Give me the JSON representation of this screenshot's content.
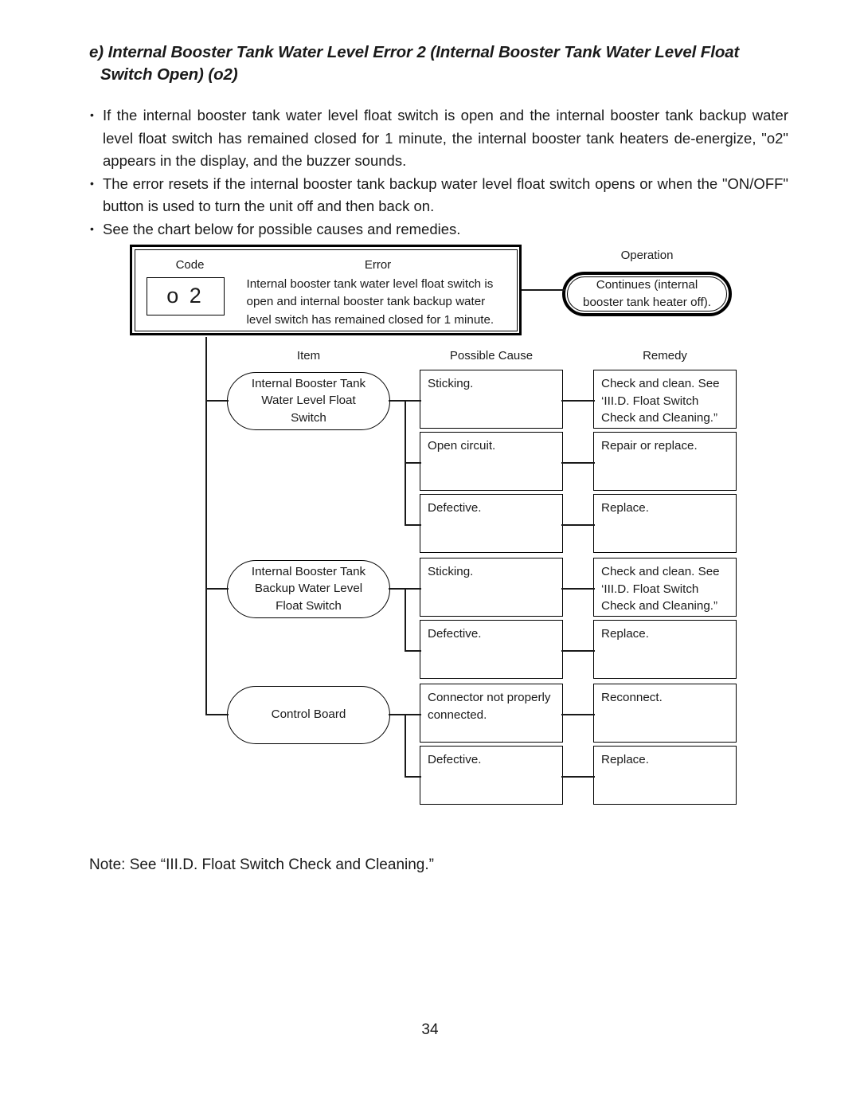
{
  "heading": {
    "line1": "e) Internal Booster Tank Water Level Error 2 (Internal Booster Tank Water Level Float",
    "line2": "Switch Open) (o2)"
  },
  "bullets": [
    "If the internal booster tank water level float switch is open and the internal booster tank backup water level float switch has remained closed for 1 minute, the internal booster tank heaters de-energize, \"o2\" appears in the display, and the buzzer sounds.",
    "The error resets if the internal booster tank backup water level float switch opens or when the \"ON/OFF\" button is used to turn the unit off and then back on.",
    "See the chart below for possible causes and remedies."
  ],
  "chart_data": {
    "type": "table",
    "title": "",
    "headers": {
      "code": "Code",
      "error": "Error",
      "operation": "Operation",
      "item": "Item",
      "possible_cause": "Possible Cause",
      "remedy": "Remedy"
    },
    "code_value": "o 2",
    "error_text": "Internal booster tank water level float switch is open and internal booster tank backup water level switch has remained closed for 1 minute.",
    "error_lines": [
      "Internal booster tank water level float switch is",
      "open and internal booster tank backup water",
      "level switch has remained closed for 1 minute."
    ],
    "operation_lines": [
      "Continues (internal",
      "booster tank heater off)."
    ],
    "groups": [
      {
        "item_lines": [
          "Internal Booster Tank",
          "Water Level Float",
          "Switch"
        ],
        "rows": [
          {
            "cause_lines": [
              "Sticking."
            ],
            "remedy_lines": [
              "Check and clean. See",
              "‘III.D. Float Switch",
              "Check and Cleaning.”"
            ]
          },
          {
            "cause_lines": [
              "Open circuit."
            ],
            "remedy_lines": [
              "Repair or replace."
            ]
          },
          {
            "cause_lines": [
              "Defective."
            ],
            "remedy_lines": [
              "Replace."
            ]
          }
        ]
      },
      {
        "item_lines": [
          "Internal Booster Tank",
          "Backup Water Level",
          "Float Switch"
        ],
        "rows": [
          {
            "cause_lines": [
              "Sticking."
            ],
            "remedy_lines": [
              "Check and clean. See",
              "‘III.D. Float Switch",
              "Check and Cleaning.”"
            ]
          },
          {
            "cause_lines": [
              "Defective."
            ],
            "remedy_lines": [
              "Replace."
            ]
          }
        ]
      },
      {
        "item_lines": [
          "Control Board"
        ],
        "rows": [
          {
            "cause_lines": [
              "Connector not properly",
              "connected."
            ],
            "remedy_lines": [
              "Reconnect."
            ]
          },
          {
            "cause_lines": [
              "Defective."
            ],
            "remedy_lines": [
              "Replace."
            ]
          }
        ]
      }
    ]
  },
  "note": "Note:  See “III.D. Float Switch Check and Cleaning.”",
  "page_number": "34"
}
